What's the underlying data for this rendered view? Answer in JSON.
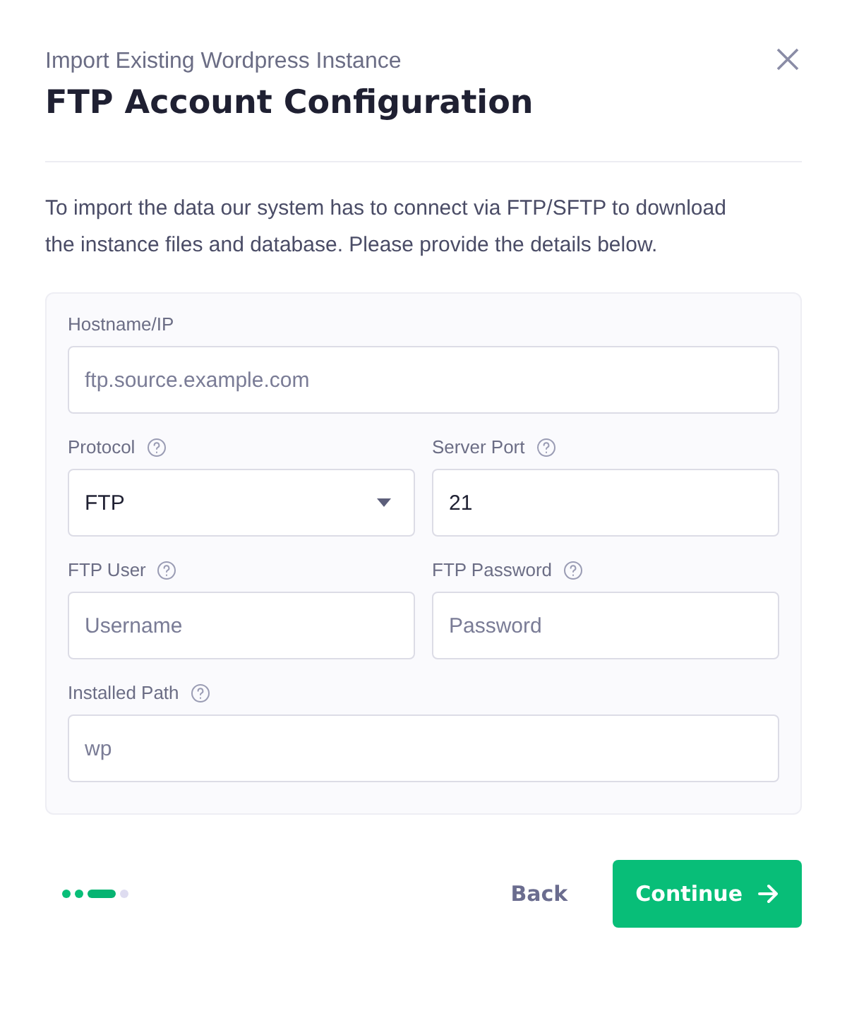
{
  "dialog": {
    "subtitle": "Import Existing Wordpress Instance",
    "title": "FTP Account Configuration"
  },
  "intro": "To import the data our system has to connect via FTP/SFTP to download the instance files and database. Please provide the details below.",
  "fields": [
    {
      "kind": "text",
      "label": "Hostname/IP",
      "help": false,
      "wide": true,
      "placeholder": "ftp.source.example.com"
    },
    {
      "kind": "select",
      "label": "Protocol",
      "help": true,
      "wide": false,
      "value": "FTP"
    },
    {
      "kind": "text",
      "label": "Server Port",
      "help": true,
      "wide": false,
      "value": "21"
    },
    {
      "kind": "text",
      "label": "FTP User",
      "help": true,
      "wide": false,
      "placeholder": "Username"
    },
    {
      "kind": "password",
      "label": "FTP Password",
      "help": true,
      "wide": false,
      "placeholder": "Password"
    },
    {
      "kind": "text",
      "label": "Installed Path",
      "help": true,
      "wide": true,
      "placeholder": "wp"
    }
  ],
  "steps": [
    {
      "done": true,
      "selected": false
    },
    {
      "done": true,
      "selected": false
    },
    {
      "done": true,
      "selected": true
    },
    {
      "done": false,
      "selected": false
    }
  ],
  "buttons": {
    "back": "Back",
    "continue": "Continue"
  }
}
